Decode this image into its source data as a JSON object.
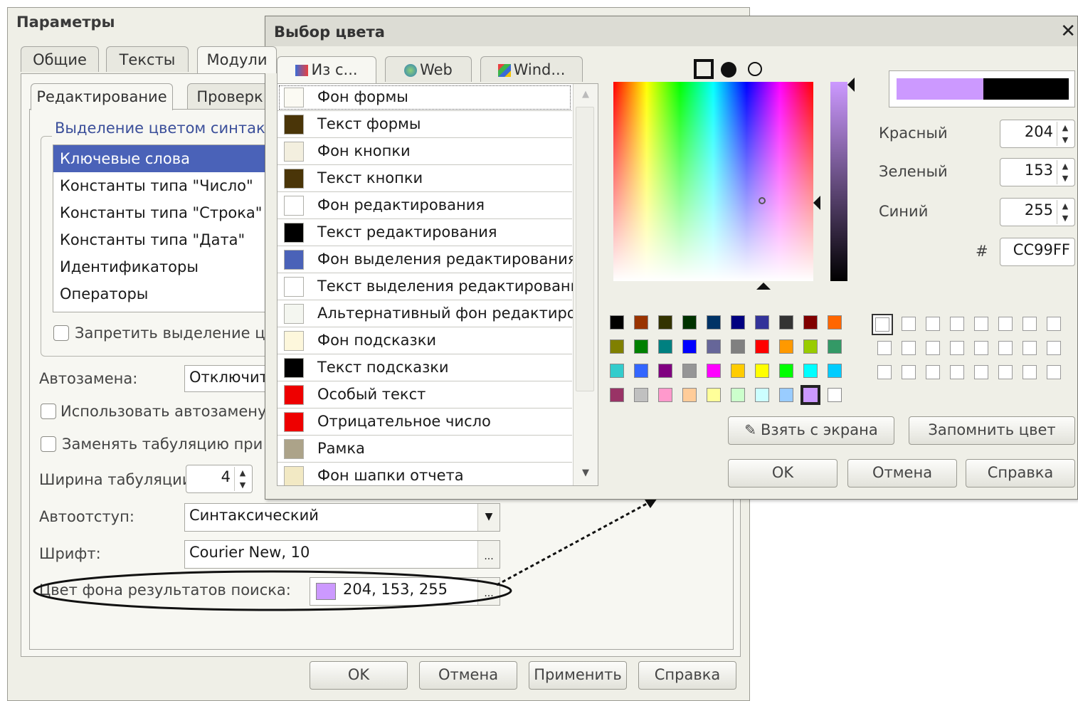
{
  "params_dialog": {
    "title": "Параметры",
    "tabs": [
      "Общие",
      "Тексты",
      "Модули"
    ],
    "subtabs": [
      "Редактирование",
      "Проверк"
    ],
    "group_title": "Выделение цветом синтакси",
    "syntax_items": [
      "Ключевые слова",
      "Константы типа \"Число\"",
      "Константы типа \"Строка\"",
      "Константы типа \"Дата\"",
      "Идентификаторы",
      "Операторы"
    ],
    "forbid_highlight_label": "Запретить выделение цве",
    "autoreplace_label": "Автозамена:",
    "autoreplace_value": "Отключить",
    "use_autoreplace_label": "Использовать автозамену в",
    "replace_tabs_label": "Заменять табуляцию при вв",
    "tab_width_label": "Ширина табуляции:",
    "tab_width_value": "4",
    "autoindent_label": "Автоотступ:",
    "autoindent_value": "Синтаксический",
    "font_label": "Шрифт:",
    "font_value": "Courier New, 10",
    "search_bg_label": "Цвет фона результатов поиска:",
    "search_bg_value": "204, 153, 255",
    "search_bg_color": "#cc99ff",
    "buttons": {
      "ok": "OK",
      "cancel": "Отмена",
      "apply": "Применить",
      "help": "Справка"
    }
  },
  "color_dialog": {
    "title": "Выбор цвета",
    "close_glyph": "✕",
    "tabs": [
      "Из с...",
      "Web",
      "Wind..."
    ],
    "style_colors": [
      {
        "label": "Фон формы",
        "color": "#fbfaf3"
      },
      {
        "label": "Текст формы",
        "color": "#4a3508"
      },
      {
        "label": "Фон кнопки",
        "color": "#f3efdf"
      },
      {
        "label": "Текст кнопки",
        "color": "#4a3508"
      },
      {
        "label": "Фон редактирования",
        "color": "#ffffff"
      },
      {
        "label": "Текст редактирования",
        "color": "#000000"
      },
      {
        "label": "Фон выделения редактирования",
        "color": "#4a62b8"
      },
      {
        "label": "Текст выделения редактирования",
        "color": "#ffffff"
      },
      {
        "label": "Альтернативный фон редактиро...",
        "color": "#f4f6f0"
      },
      {
        "label": "Фон подсказки",
        "color": "#fdf7dc"
      },
      {
        "label": "Текст подсказки",
        "color": "#000000"
      },
      {
        "label": "Особый текст",
        "color": "#ee0000"
      },
      {
        "label": "Отрицательное число",
        "color": "#ee0000"
      },
      {
        "label": "Рамка",
        "color": "#aca389"
      },
      {
        "label": "Фон шапки отчета",
        "color": "#f2e9c4"
      }
    ],
    "palette": [
      [
        "#000000",
        "#993300",
        "#333300",
        "#003300",
        "#003366",
        "#000080",
        "#333399",
        "#333333",
        "#800000",
        "#ff6600"
      ],
      [
        "#808000",
        "#008000",
        "#008080",
        "#0000ff",
        "#666699",
        "#808080",
        "#ff0000",
        "#ff9900",
        "#99cc00",
        "#339966"
      ],
      [
        "#33cccc",
        "#3366ff",
        "#800080",
        "#969696",
        "#ff00ff",
        "#ffcc00",
        "#ffff00",
        "#00ff00",
        "#00ffff",
        "#00ccff"
      ],
      [
        "#993366",
        "#c0c0c0",
        "#ff99cc",
        "#ffcc99",
        "#ffff99",
        "#ccffcc",
        "#ccffff",
        "#99ccff",
        "#cc99ff",
        "#ffffff"
      ]
    ],
    "selected_palette": "#cc99ff",
    "red_label": "Красный",
    "green_label": "Зеленый",
    "blue_label": "Синий",
    "red_value": "204",
    "green_value": "153",
    "blue_value": "255",
    "hash_label": "#",
    "hex_value": "CC99FF",
    "preview_new": "#cc99ff",
    "preview_old": "#000000",
    "pick_screen_label": "Взять с экрана",
    "remember_label": "Запомнить цвет",
    "buttons": {
      "ok": "OK",
      "cancel": "Отмена",
      "help": "Справка"
    }
  }
}
